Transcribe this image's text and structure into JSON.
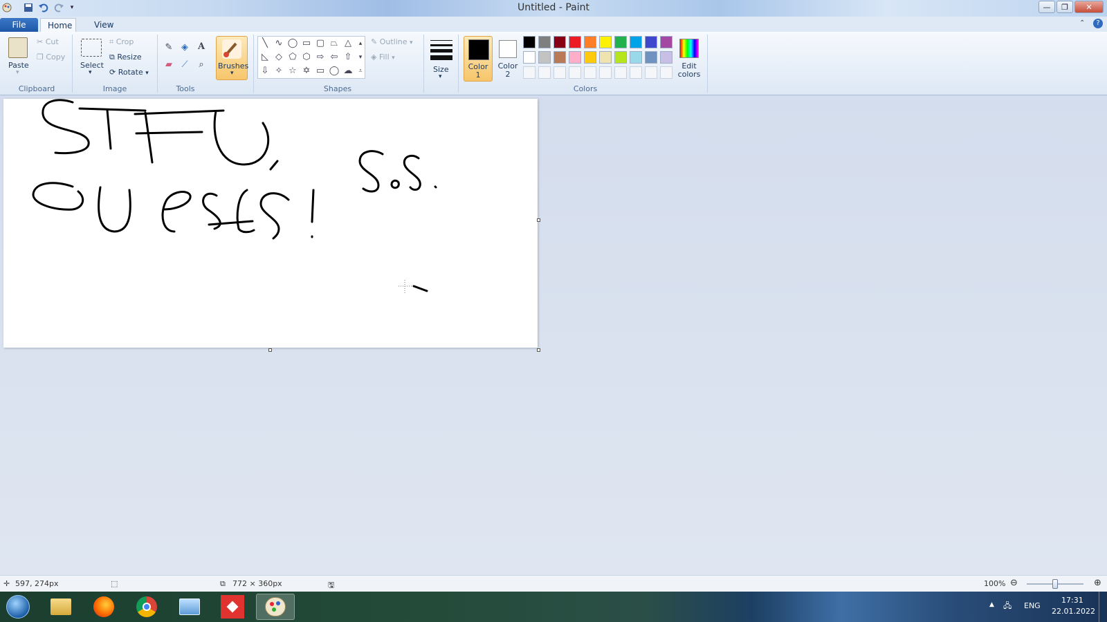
{
  "window": {
    "title": "Untitled - Paint"
  },
  "tabs": {
    "file": "File",
    "home": "Home",
    "view": "View"
  },
  "clipboard": {
    "paste": "Paste",
    "cut": "Cut",
    "copy": "Copy",
    "group": "Clipboard"
  },
  "image": {
    "select": "Select",
    "crop": "Crop",
    "resize": "Resize",
    "rotate": "Rotate",
    "group": "Image"
  },
  "tools": {
    "group": "Tools",
    "brushes": "Brushes"
  },
  "shapes": {
    "outline": "Outline",
    "fill": "Fill",
    "group": "Shapes"
  },
  "size": {
    "label": "Size"
  },
  "colors": {
    "color1": "Color",
    "color1_num": "1",
    "color2": "Color",
    "color2_num": "2",
    "edit": "Edit",
    "edit2": "colors",
    "group": "Colors",
    "row1": [
      "#000000",
      "#7f7f7f",
      "#880015",
      "#ed1c24",
      "#ff7f27",
      "#fff200",
      "#22b14c",
      "#00a2e8",
      "#3f48cc",
      "#a349a4"
    ],
    "row2": [
      "#ffffff",
      "#c3c3c3",
      "#b97a57",
      "#ffaec9",
      "#ffc90e",
      "#efe4b0",
      "#b5e61d",
      "#99d9ea",
      "#7092be",
      "#c8bfe7"
    ]
  },
  "status": {
    "cursor": "597, 274px",
    "size": "772 × 360px",
    "zoom": "100%"
  },
  "tray": {
    "lang": "ENG",
    "time": "17:31",
    "date": "22.01.2022"
  }
}
